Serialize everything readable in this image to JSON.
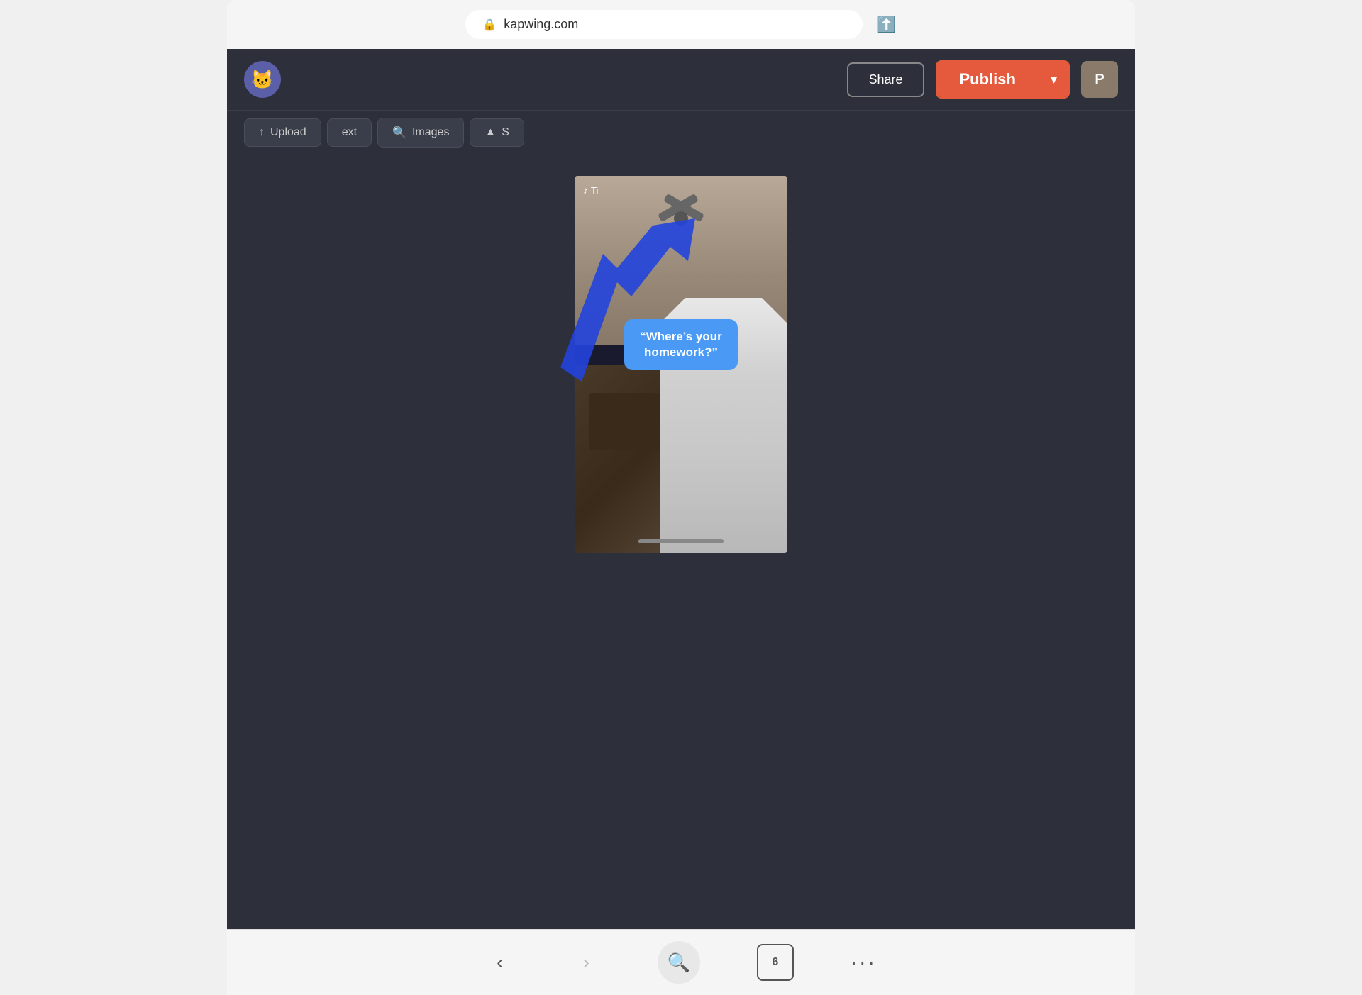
{
  "browser": {
    "url": "kapwing.com",
    "lock_icon": "🔒",
    "share_icon": "⬆",
    "back_disabled": false,
    "forward_disabled": false,
    "tabs_count": "6"
  },
  "header": {
    "logo_emoji": "🐱",
    "share_label": "Share",
    "publish_label": "Publish",
    "dropdown_icon": "▾",
    "user_initial": "P"
  },
  "toolbar": {
    "upload_label": "Upload",
    "text_label": "ext",
    "images_label": "Images",
    "scenes_label": "S"
  },
  "video": {
    "tiktok_label": "Ti",
    "caption_text": "“Where’s your homework?”"
  },
  "bottom_bar": {
    "back_label": "‹",
    "forward_label": "›",
    "search_icon": "🔍",
    "tabs_label": "6",
    "more_label": "•••"
  }
}
